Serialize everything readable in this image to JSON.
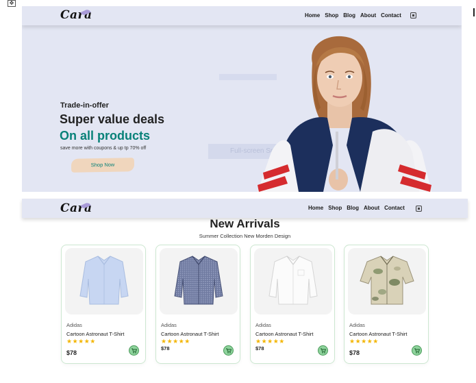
{
  "brand": {
    "logo_text": "Cara"
  },
  "nav": {
    "items": [
      {
        "label": "Home"
      },
      {
        "label": "Shop"
      },
      {
        "label": "Blog"
      },
      {
        "label": "About"
      },
      {
        "label": "Contact"
      }
    ],
    "cart_icon": "bag-icon"
  },
  "hero": {
    "kicker": "Trade-in-offer",
    "title": "Super value deals",
    "subtitle": "On all products",
    "copy": "save more with coupons & up tp 70% off",
    "button_label": "Shop Now",
    "ghost_overlay_text": "Full-screen Sn"
  },
  "products_section": {
    "title": "New Arrivals",
    "subtitle": "Summer Collection New Morden Design",
    "products": [
      {
        "brand": "Adidas",
        "name": "Cartoon Astronaut T-Shirt",
        "stars": "★★★★★",
        "rating": 5,
        "price": "$78",
        "shirt": "light-blue"
      },
      {
        "brand": "Adidas",
        "name": "Cartoon Astronaut T-Shirt",
        "stars": "★★★★★",
        "rating": 5,
        "price": "$78",
        "shirt": "navy-gingham"
      },
      {
        "brand": "Adidas",
        "name": "Cartoon Astronaut T-Shirt",
        "stars": "★★★★★",
        "rating": 5,
        "price": "$78",
        "shirt": "white"
      },
      {
        "brand": "Adidas",
        "name": "Cartoon Astronaut T-Shirt",
        "stars": "★★★★★",
        "rating": 5,
        "price": "$78",
        "shirt": "camo-print"
      }
    ]
  },
  "colors": {
    "accent": "#088178",
    "nav_bg": "#e3e6f3",
    "star": "#f3b500",
    "cart_button": "#8ed39c"
  }
}
